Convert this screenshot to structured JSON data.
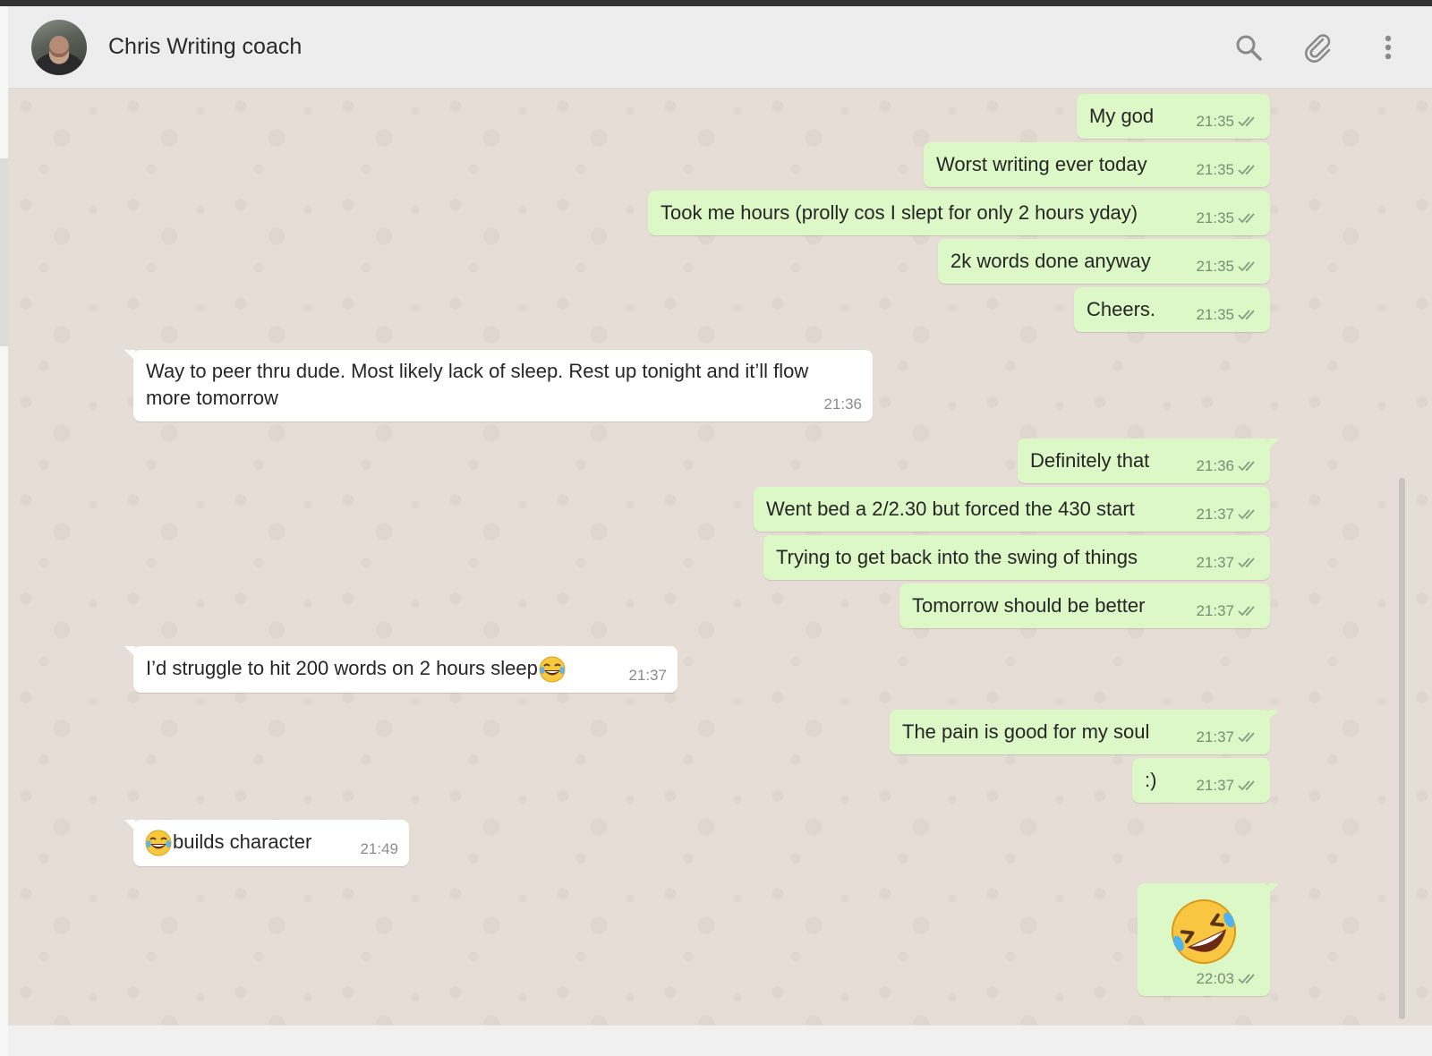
{
  "header": {
    "contact_name": "Chris Writing coach",
    "icons": [
      "search-icon",
      "paperclip-icon",
      "more-vertical-icon"
    ]
  },
  "colors": {
    "outgoing_bubble": "#dcf8c6",
    "incoming_bubble": "#ffffff",
    "chat_background": "#e6ded6",
    "ticks": "#8a9a86"
  },
  "messages": [
    {
      "dir": "out",
      "text": "My god",
      "time": "21:35",
      "status": "double-tick"
    },
    {
      "dir": "out",
      "text": "Worst writing ever today",
      "time": "21:35",
      "status": "double-tick"
    },
    {
      "dir": "out",
      "text": "Took me hours (prolly cos I slept for only 2 hours yday)",
      "time": "21:35",
      "status": "double-tick"
    },
    {
      "dir": "out",
      "text": "2k words done anyway",
      "time": "21:35",
      "status": "double-tick"
    },
    {
      "dir": "out",
      "text": "Cheers.",
      "time": "21:35",
      "status": "double-tick"
    },
    {
      "dir": "in",
      "text_line1": "Way to peer thru dude.  Most likely lack of sleep. Rest up tonight and it’ll flow",
      "text_line2": "more tomorrow",
      "time": "21:36"
    },
    {
      "dir": "out",
      "text": "Definitely that",
      "time": "21:36",
      "status": "double-tick"
    },
    {
      "dir": "out",
      "text": "Went bed a 2/2.30 but forced the 430 start",
      "time": "21:37",
      "status": "double-tick"
    },
    {
      "dir": "out",
      "text": "Trying to get back into the swing of things",
      "time": "21:37",
      "status": "double-tick"
    },
    {
      "dir": "out",
      "text": "Tomorrow should be better",
      "time": "21:37",
      "status": "double-tick"
    },
    {
      "dir": "in",
      "text": "I’d struggle to hit 200 words on 2 hours sleep ",
      "emoji": "laughing-tears-emoji",
      "time": "21:37"
    },
    {
      "dir": "out",
      "text": "The pain is good for my soul",
      "time": "21:37",
      "status": "double-tick"
    },
    {
      "dir": "out",
      "text": ":)",
      "time": "21:37",
      "status": "double-tick"
    },
    {
      "dir": "in",
      "text": "builds character",
      "emoji": "laughing-tears-emoji",
      "time": "21:49"
    },
    {
      "dir": "out",
      "emoji": "rolling-on-floor-laughing-emoji",
      "time": "22:03",
      "status": "double-tick"
    }
  ]
}
